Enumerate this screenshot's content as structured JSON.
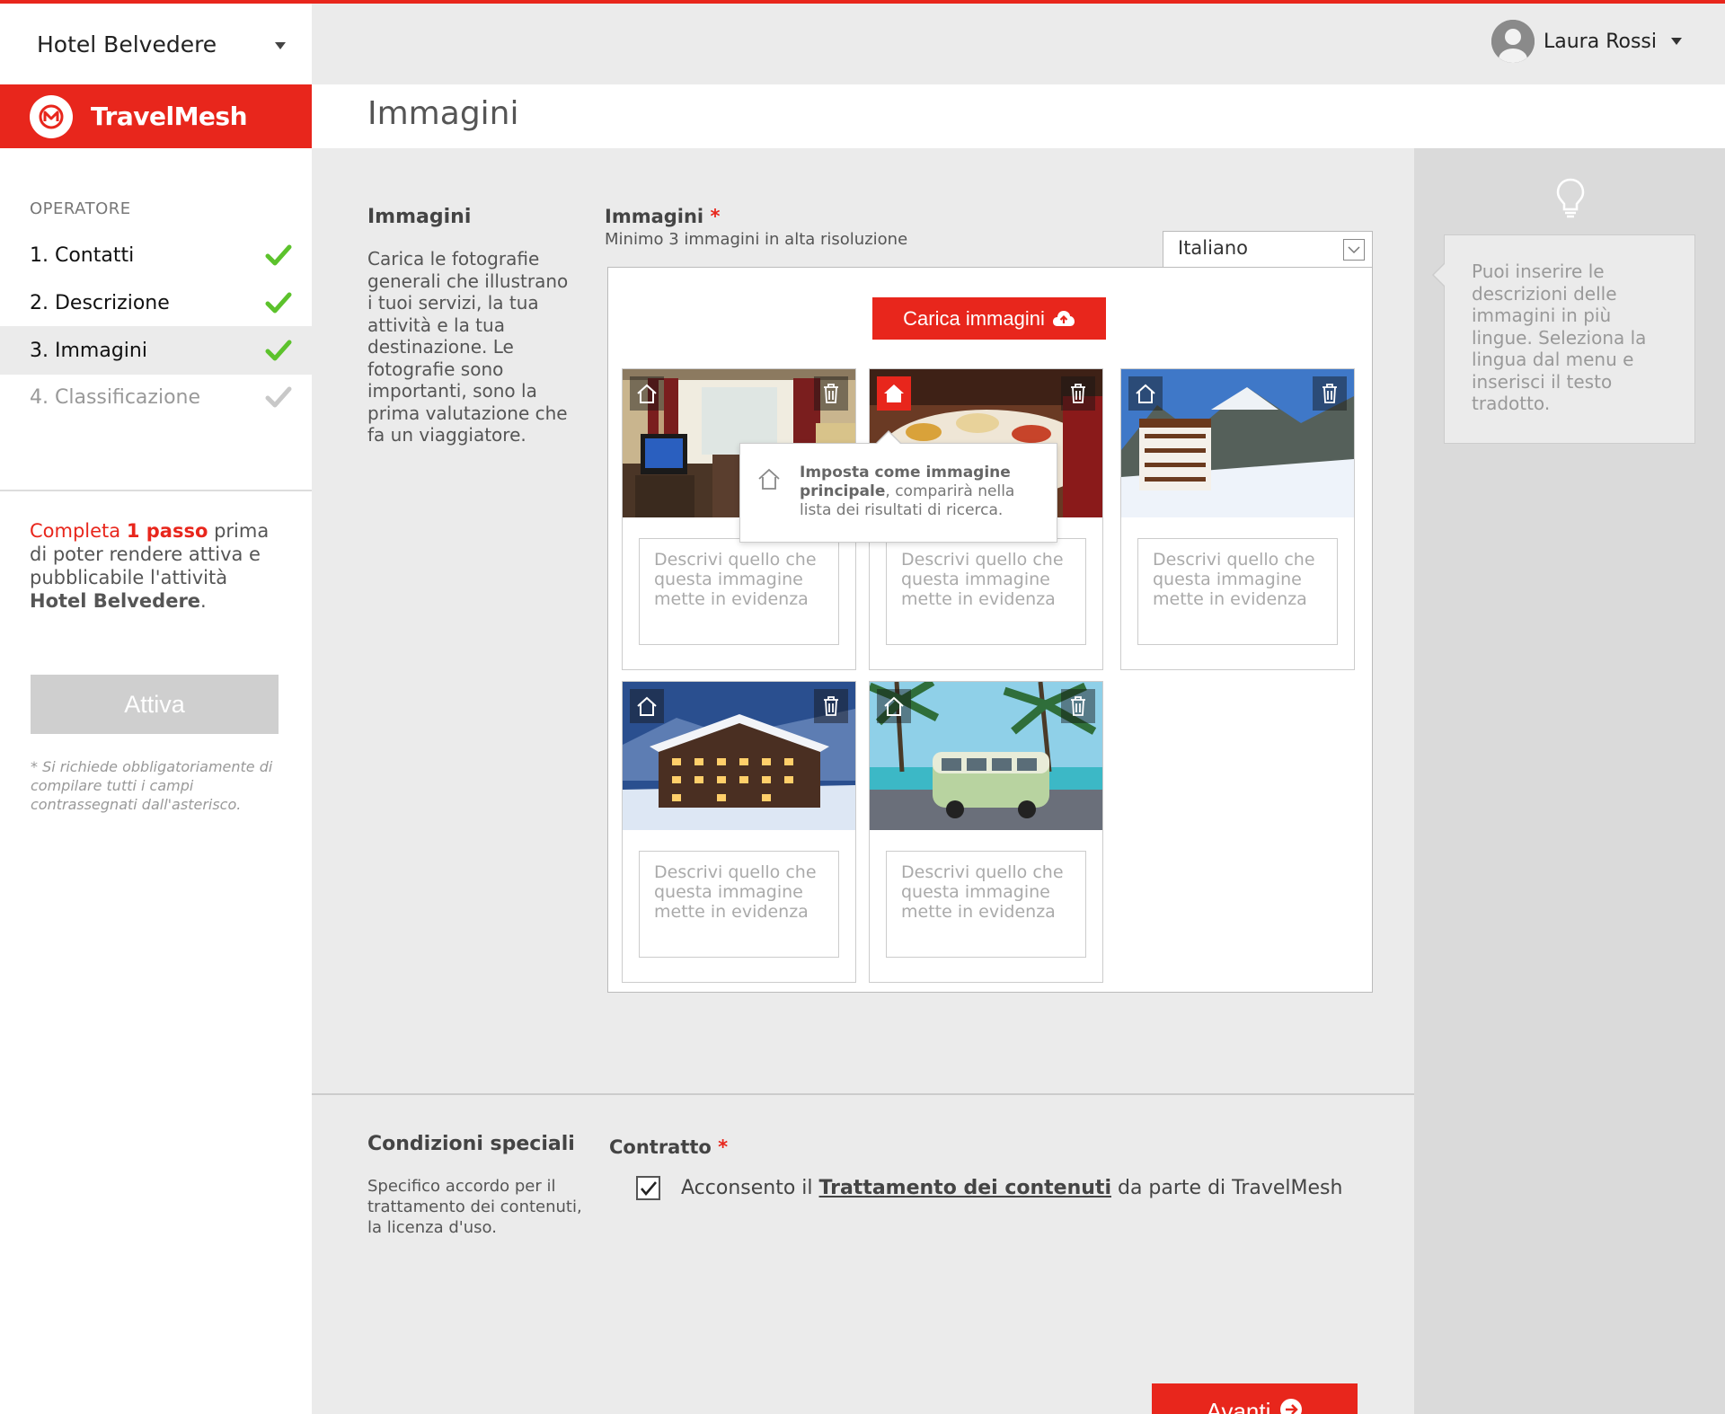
{
  "hotel_selector": {
    "label": "Hotel Belvedere"
  },
  "brand": {
    "name": "TravelMesh",
    "color": "#e8261c"
  },
  "user": {
    "name": "Laura Rossi"
  },
  "page": {
    "title": "Immagini"
  },
  "sidebar": {
    "section_label": "OPERATORE",
    "steps": [
      {
        "label": "1. Contatti",
        "done": true
      },
      {
        "label": "2. Descrizione",
        "done": true
      },
      {
        "label": "3. Immagini",
        "done": true,
        "active": true
      },
      {
        "label": "4. Classificazione",
        "done": false
      }
    ],
    "notice": {
      "red_prefix": "Completa",
      "red_bold": "1 passo",
      "text": "prima di poter rendere attiva e pubblicabile l'attività",
      "hotel": "Hotel Belvedere",
      "suffix": "."
    },
    "activate_button": "Attiva",
    "footnote": "* Si richiede obbligatoriamente di compilare tutti i campi contrassegnati dall'asterisco."
  },
  "images_section": {
    "title": "Immagini",
    "description": "Carica le fotografie generali che illustrano i tuoi servizi, la tua attività e la tua destinazione. Le fotografie sono importanti, sono la prima valutazione che fa un viaggiatore.",
    "field_label": "Immagini",
    "required_mark": "*",
    "field_hint": "Minimo 3 immagini in alta risoluzione",
    "language": "Italiano",
    "upload_button": "Carica immagini",
    "description_placeholder": "Descrivi quello che questa immagine mette in evidenza",
    "images": [
      {
        "subject": "hotel room with TV and curtains",
        "main": false
      },
      {
        "subject": "restaurant buffet",
        "main": true
      },
      {
        "subject": "alpine chalet in snow",
        "main": false
      },
      {
        "subject": "hotel at night in snow",
        "main": false
      },
      {
        "subject": "vintage van under palm trees",
        "main": false
      }
    ],
    "tooltip": {
      "bold": "Imposta come immagine principale",
      "text": ", comparirà nella lista dei risultati di ricerca."
    }
  },
  "help_panel": {
    "text": "Puoi inserire le descrizioni delle immagini in più lingue. Seleziona la lingua dal menu e inserisci il testo tradotto."
  },
  "special_conditions": {
    "title": "Condizioni speciali",
    "description": "Specifico accordo per il trattamento dei contenuti, la licenza d'uso.",
    "field_label": "Contratto",
    "required_mark": "*",
    "consent_prefix": "Acconsento il",
    "consent_link": "Trattamento dei contenuti",
    "consent_suffix": "da parte di TravelMesh",
    "checked": true
  },
  "next_button": "Avanti",
  "icons": [
    "chevron-down-icon",
    "travelmesh-logo-icon",
    "check-icon",
    "avatar-icon",
    "lightbulb-icon",
    "upload-cloud-icon",
    "home-icon",
    "trash-icon",
    "arrow-right-circle-icon"
  ]
}
